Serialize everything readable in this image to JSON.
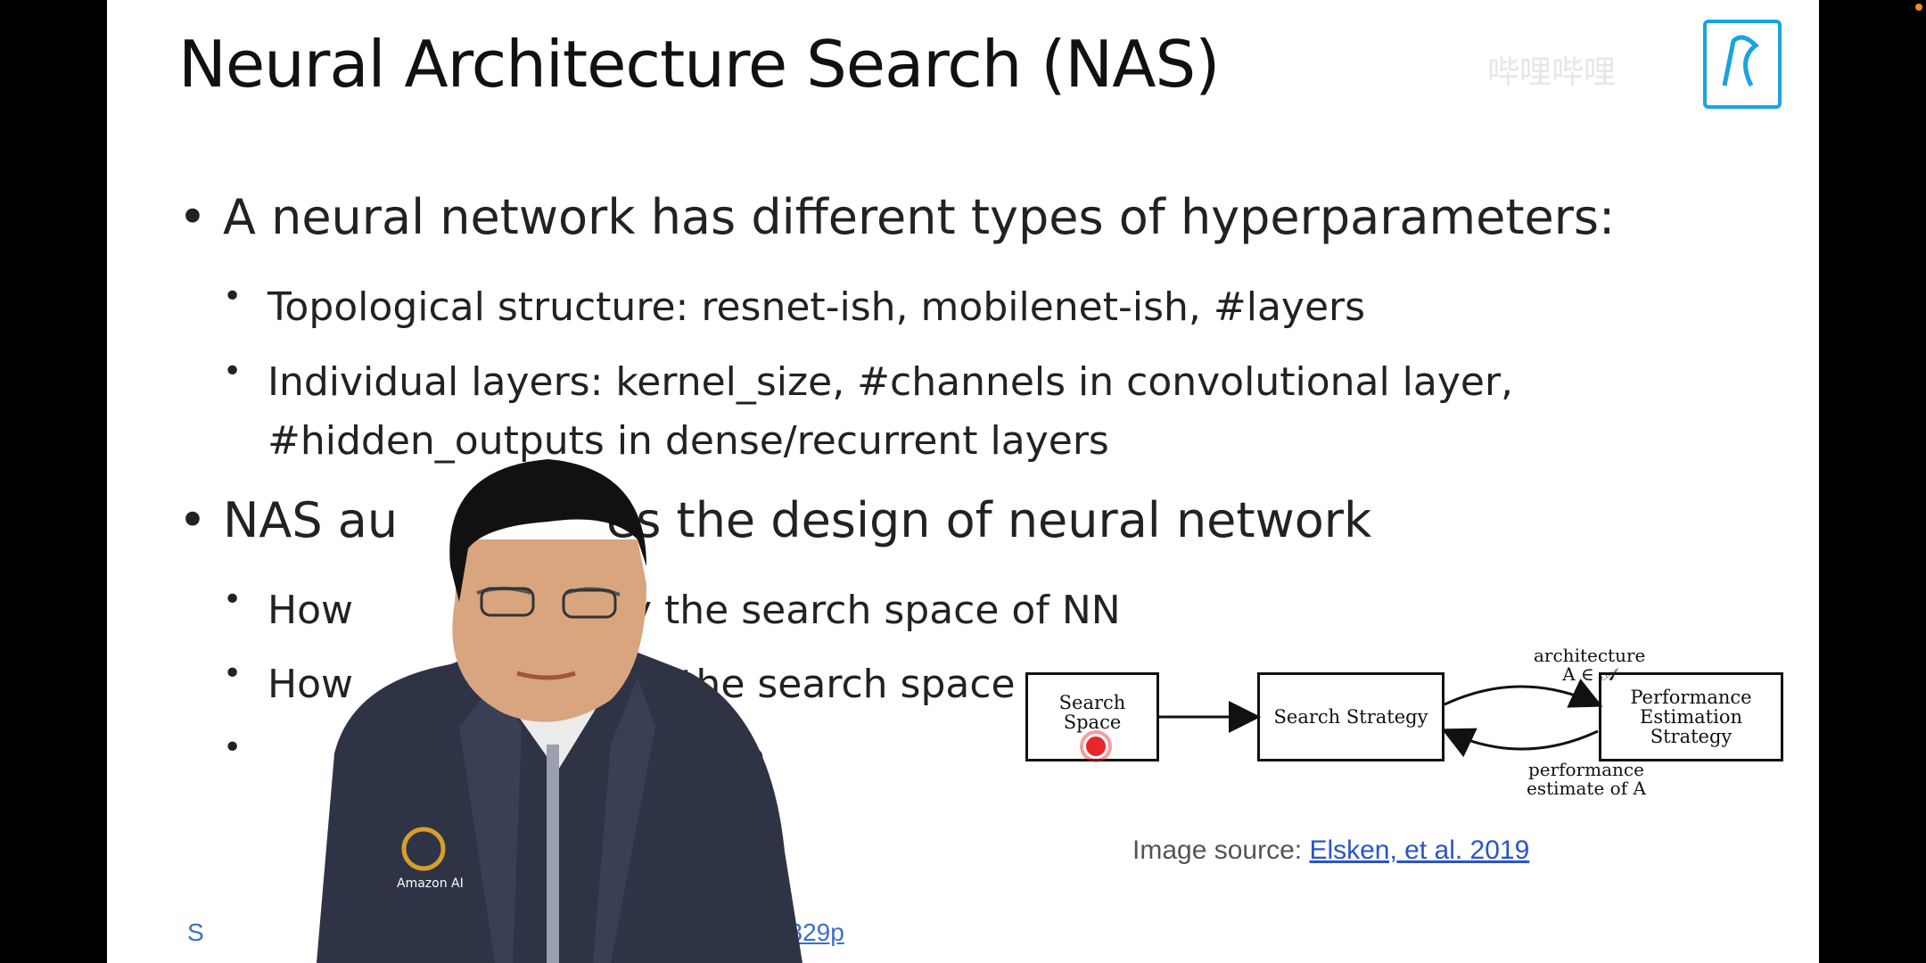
{
  "slide": {
    "title": "Neural Architecture Search (NAS)",
    "bullets": [
      {
        "text": "A neural network has different types of hyperparameters:",
        "sub": [
          "Topological structure: resnet-ish, mobilenet-ish, #layers",
          "Individual layers: kernel_size, #channels in convolutional layer,",
          "#hidden_outputs in dense/recurrent layers"
        ]
      },
      {
        "text_visible_left": "NAS au",
        "text_visible_right": "es the design of neural network",
        "sub": [
          {
            "left": "How",
            "right": "y the search space of NN"
          },
          {
            "left": "How",
            "right": "re the search space"
          },
          {
            "left": "",
            "right": "mation"
          }
        ]
      }
    ],
    "diagram": {
      "search_space": "Search Space",
      "search_strategy": "Search Strategy",
      "performance": [
        "Performance",
        "Estimation",
        "Strategy"
      ],
      "top_label": [
        "architecture",
        "A ∈ 𝒜"
      ],
      "bottom_label": [
        "performance",
        "estimate of A"
      ]
    },
    "source_prefix": "Image source: ",
    "source_link": "Elsken, et al. 2019",
    "footer_left": "S",
    "footer_link": "tanford-cs329p",
    "watermark": "哔哩哔哩"
  },
  "presenter": {
    "shirt_logo_text": "Amazon AI"
  },
  "colors": {
    "link": "#2a55c8",
    "logo": "#1aa3e0",
    "cursor": "#e8262c"
  }
}
